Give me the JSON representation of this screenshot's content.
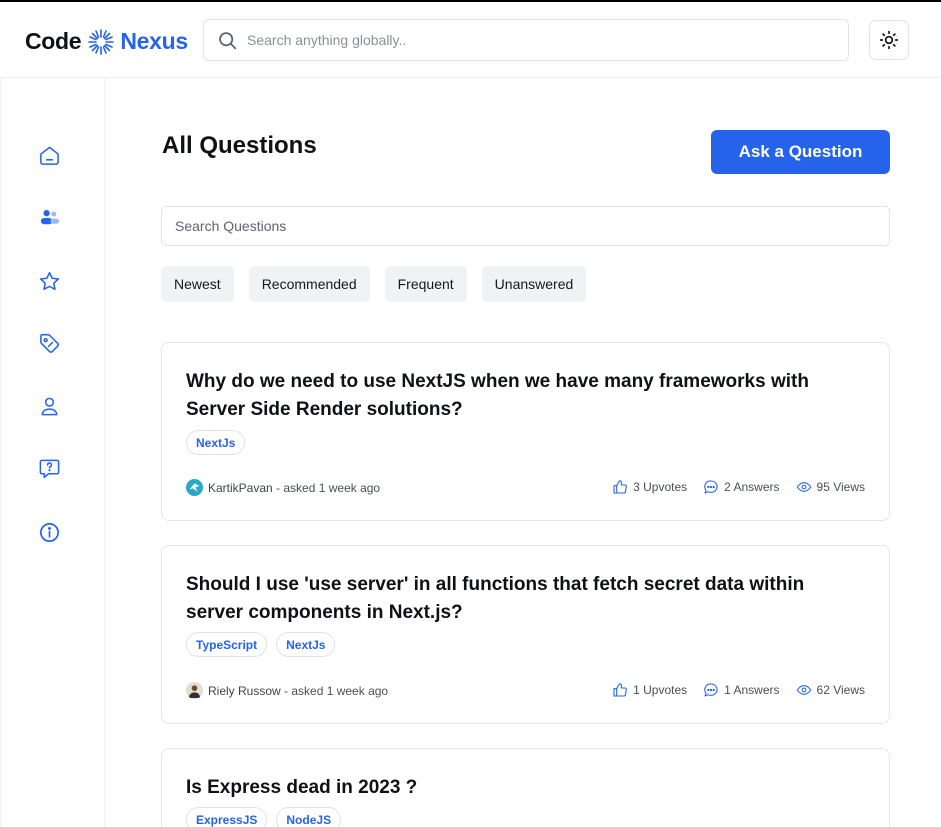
{
  "brand": {
    "left": "Code",
    "right": "Nexus",
    "accent": "#2563eb"
  },
  "global_search": {
    "placeholder": "Search anything globally.."
  },
  "sidebar": {
    "items": [
      "home-icon",
      "community-icon",
      "star-icon",
      "tag-icon",
      "profile-icon",
      "question-icon",
      "info-icon"
    ]
  },
  "page": {
    "title": "All Questions",
    "ask_label": "Ask a Question",
    "search_placeholder": "Search Questions",
    "filters": [
      "Newest",
      "Recommended",
      "Frequent",
      "Unanswered"
    ]
  },
  "questions": [
    {
      "title": "Why do we need to use NextJS when we have many frameworks with Server Side Render solutions?",
      "tags": [
        "NextJs"
      ],
      "author": "KartikPavan",
      "asked": " - asked 1 week ago",
      "upvotes": "3 Upvotes",
      "answers": "2 Answers",
      "views": "95 Views"
    },
    {
      "title": "Should I use 'use server' in all functions that fetch secret data within server components in Next.js?",
      "tags": [
        "TypeScript",
        "NextJs"
      ],
      "author": "Riely Russow",
      "asked": " - asked 1 week ago",
      "upvotes": "1 Upvotes",
      "answers": "1 Answers",
      "views": "62 Views"
    },
    {
      "title": "Is Express dead in 2023 ?",
      "tags": [
        "ExpressJS",
        "NodeJS"
      ]
    }
  ]
}
